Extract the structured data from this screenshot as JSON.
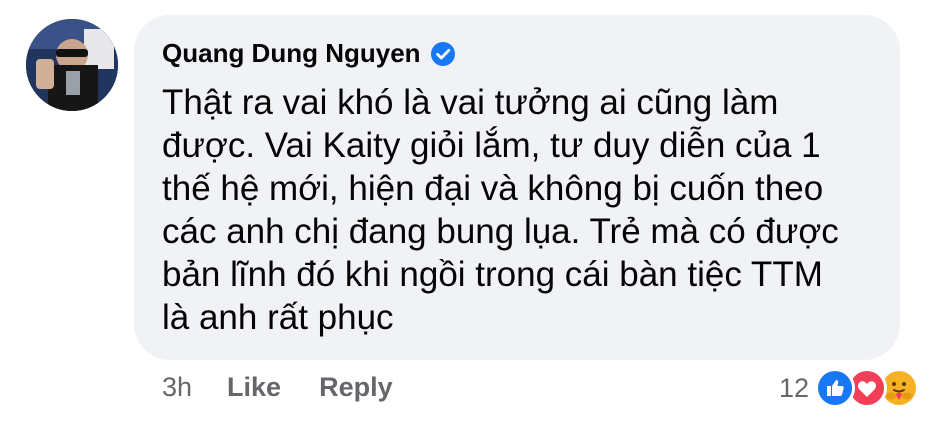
{
  "comment": {
    "author": "Quang Dung Nguyen",
    "lines": [
      "Thật ra vai khó là vai tưởng ai cũng làm",
      "được. Vai Kaity giỏi lắm, tư duy diễn của 1",
      "thế hệ mới, hiện đại và không bị cuốn theo",
      "các anh chị đang bung lụa. Trẻ mà có được",
      "bản lĩnh đó khi ngồi trong cái bàn tiệc TTM",
      "là anh rất phục"
    ],
    "time": "3h",
    "like_label": "Like",
    "reply_label": "Reply",
    "reaction_count": "12",
    "reactions": [
      "like-reaction-icon",
      "love-reaction-icon",
      "care-reaction-icon"
    ],
    "verified_icon": "verified-badge-icon"
  },
  "colors": {
    "bubble": "#f0f2f5",
    "text": "#050505",
    "secondary": "#65676b",
    "verified": "#1877f2",
    "like": "#1877f2",
    "love": "#f33e58",
    "care": "#f7b125"
  }
}
